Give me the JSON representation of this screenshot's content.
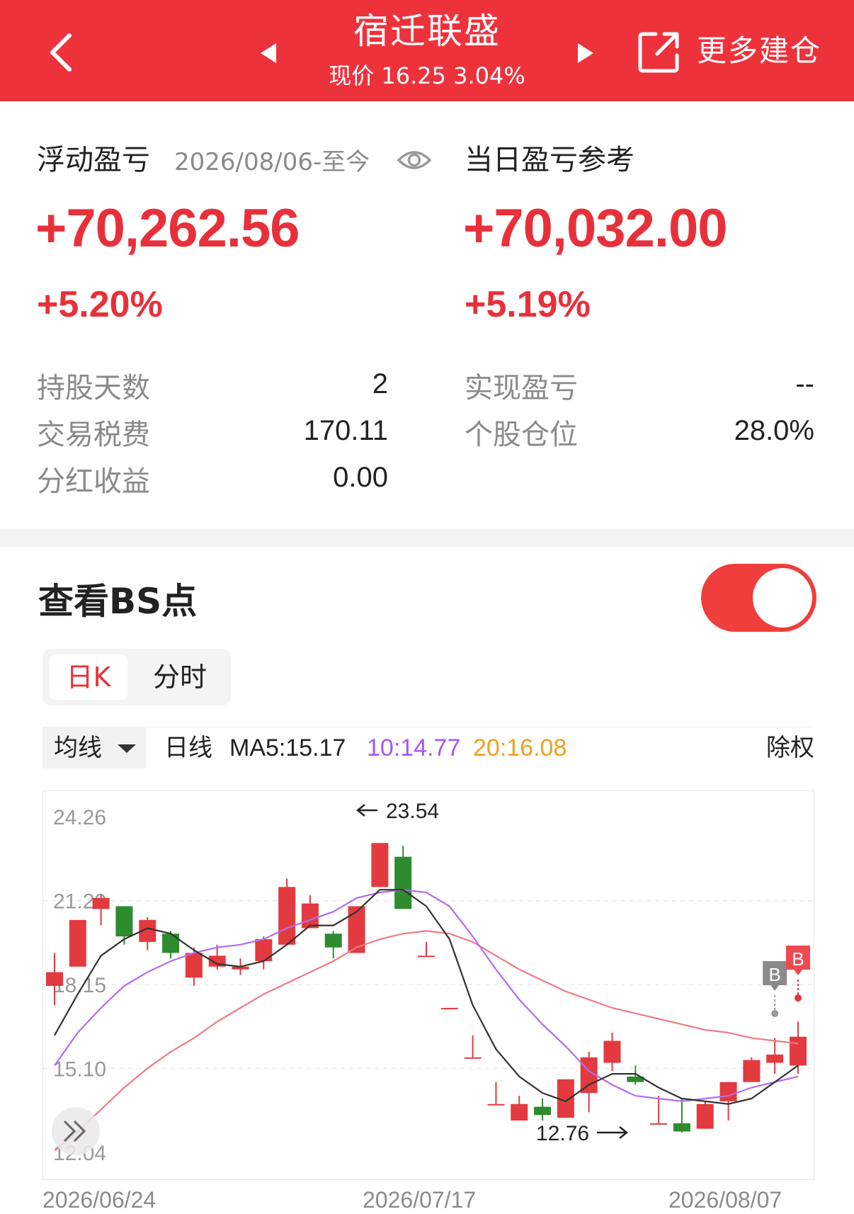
{
  "header": {
    "title": "宿迁联盛",
    "subtitle": "现价 16.25 3.04%",
    "more_label": "更多建仓",
    "icons": [
      "back-arrow-icon",
      "prev-triangle-icon",
      "next-triangle-icon",
      "share-icon"
    ]
  },
  "floating_pnl": {
    "label": "浮动盈亏",
    "period": "2026/08/06-至今",
    "value": "+70,262.56",
    "percent": "+5.20%",
    "eye_icon": "eye-icon"
  },
  "daily_pnl": {
    "label": "当日盈亏参考",
    "value": "+70,032.00",
    "percent": "+5.19%"
  },
  "stats_left": [
    {
      "key": "持股天数",
      "value": "2"
    },
    {
      "key": "交易税费",
      "value": "170.11"
    },
    {
      "key": "分红收益",
      "value": "0.00"
    }
  ],
  "stats_right": [
    {
      "key": "实现盈亏",
      "value": "--"
    },
    {
      "key": "个股仓位",
      "value": "28.0%"
    }
  ],
  "bs": {
    "title": "查看BS点",
    "toggle_on": true
  },
  "tabs": {
    "active": "日K",
    "other": "分时"
  },
  "ma_bar": {
    "dropdown": "均线",
    "line_label": "日线",
    "ma5": "MA5:15.17",
    "ma10": "10:14.77",
    "ma20": "20:16.08",
    "adjust": "除权",
    "colors": {
      "ma5": "#222222",
      "ma10": "#a855f7",
      "ma20": "#f0a020"
    }
  },
  "chart_data": {
    "type": "candlestick",
    "y_ticks": [
      "24.26",
      "21.20",
      "18.15",
      "15.10",
      "12.04"
    ],
    "ylim": [
      12.04,
      24.26
    ],
    "x_labels": [
      "2026/06/24",
      "2026/07/17",
      "2026/08/07"
    ],
    "max_annotation": "23.54",
    "min_annotation": "12.76",
    "marker_b1": "B",
    "marker_b2": "B",
    "candles": [
      {
        "o": 18.1,
        "c": 18.6,
        "h": 19.3,
        "l": 17.4
      },
      {
        "o": 18.8,
        "c": 20.5,
        "h": 20.5,
        "l": 18.8
      },
      {
        "o": 20.9,
        "c": 21.3,
        "h": 21.4,
        "l": 20.3
      },
      {
        "o": 21.0,
        "c": 19.9,
        "h": 21.0,
        "l": 19.6
      },
      {
        "o": 19.7,
        "c": 20.5,
        "h": 20.6,
        "l": 19.4
      },
      {
        "o": 20.0,
        "c": 19.3,
        "h": 20.1,
        "l": 19.1
      },
      {
        "o": 18.4,
        "c": 19.3,
        "h": 19.5,
        "l": 18.1
      },
      {
        "o": 18.8,
        "c": 19.2,
        "h": 19.6,
        "l": 18.7
      },
      {
        "o": 18.7,
        "c": 18.8,
        "h": 19.1,
        "l": 18.5
      },
      {
        "o": 19.0,
        "c": 19.8,
        "h": 19.9,
        "l": 18.7
      },
      {
        "o": 19.6,
        "c": 21.7,
        "h": 22.0,
        "l": 19.6
      },
      {
        "o": 20.2,
        "c": 21.1,
        "h": 21.4,
        "l": 20.2
      },
      {
        "o": 20.0,
        "c": 19.5,
        "h": 20.1,
        "l": 19.1
      },
      {
        "o": 19.3,
        "c": 21.0,
        "h": 21.0,
        "l": 19.3
      },
      {
        "o": 21.7,
        "c": 23.3,
        "h": 23.3,
        "l": 21.7
      },
      {
        "o": 22.8,
        "c": 20.9,
        "h": 23.2,
        "l": 20.9
      },
      {
        "o": 19.2,
        "c": 19.2,
        "h": 19.7,
        "l": 19.2
      },
      {
        "o": 17.3,
        "c": 17.3,
        "h": 17.3,
        "l": 17.3
      },
      {
        "o": 15.5,
        "c": 15.5,
        "h": 16.3,
        "l": 15.5
      },
      {
        "o": 13.8,
        "c": 13.8,
        "h": 14.6,
        "l": 13.8
      },
      {
        "o": 13.2,
        "c": 13.8,
        "h": 14.1,
        "l": 13.2
      },
      {
        "o": 13.7,
        "c": 13.4,
        "h": 14.0,
        "l": 13.2
      },
      {
        "o": 13.3,
        "c": 14.7,
        "h": 14.7,
        "l": 13.3
      },
      {
        "o": 14.2,
        "c": 15.5,
        "h": 15.7,
        "l": 13.5
      },
      {
        "o": 15.3,
        "c": 16.1,
        "h": 16.4,
        "l": 15.0
      },
      {
        "o": 14.8,
        "c": 14.6,
        "h": 15.2,
        "l": 14.5
      },
      {
        "o": 13.1,
        "c": 13.1,
        "h": 14.1,
        "l": 13.1
      },
      {
        "o": 13.1,
        "c": 12.8,
        "h": 14.0,
        "l": 12.76
      },
      {
        "o": 12.9,
        "c": 13.8,
        "h": 13.9,
        "l": 12.9
      },
      {
        "o": 13.9,
        "c": 14.6,
        "h": 14.6,
        "l": 13.2
      },
      {
        "o": 14.6,
        "c": 15.4,
        "h": 15.5,
        "l": 14.6
      },
      {
        "o": 15.3,
        "c": 15.6,
        "h": 16.2,
        "l": 14.9
      },
      {
        "o": 15.2,
        "c": 16.25,
        "h": 16.8,
        "l": 14.9
      }
    ],
    "ma5_series": [
      16.3,
      17.8,
      19.2,
      19.8,
      20.2,
      20.0,
      19.4,
      18.9,
      18.8,
      19.0,
      19.6,
      20.3,
      20.3,
      20.8,
      21.6,
      21.6,
      21.0,
      19.8,
      17.4,
      15.8,
      14.8,
      14.2,
      13.9,
      14.5,
      14.9,
      14.9,
      14.4,
      14.0,
      13.9,
      13.8,
      14.0,
      14.6,
      15.2
    ],
    "ma10_series": [
      15.2,
      16.4,
      17.3,
      18.1,
      18.6,
      19.0,
      19.3,
      19.5,
      19.6,
      19.8,
      20.2,
      20.5,
      20.8,
      21.3,
      21.5,
      21.6,
      21.5,
      21.0,
      19.9,
      18.7,
      17.6,
      16.7,
      15.9,
      15.0,
      14.5,
      14.1,
      14.0,
      13.9,
      14.0,
      14.1,
      14.4,
      14.6,
      14.8
    ],
    "ma20_series": [
      12.1,
      12.8,
      13.6,
      14.4,
      15.1,
      15.7,
      16.2,
      16.8,
      17.3,
      17.8,
      18.2,
      18.6,
      19.0,
      19.5,
      19.8,
      20.0,
      20.1,
      20.0,
      19.7,
      19.2,
      18.7,
      18.3,
      17.9,
      17.6,
      17.3,
      17.1,
      16.9,
      16.7,
      16.5,
      16.4,
      16.2,
      16.1,
      16.0
    ]
  }
}
